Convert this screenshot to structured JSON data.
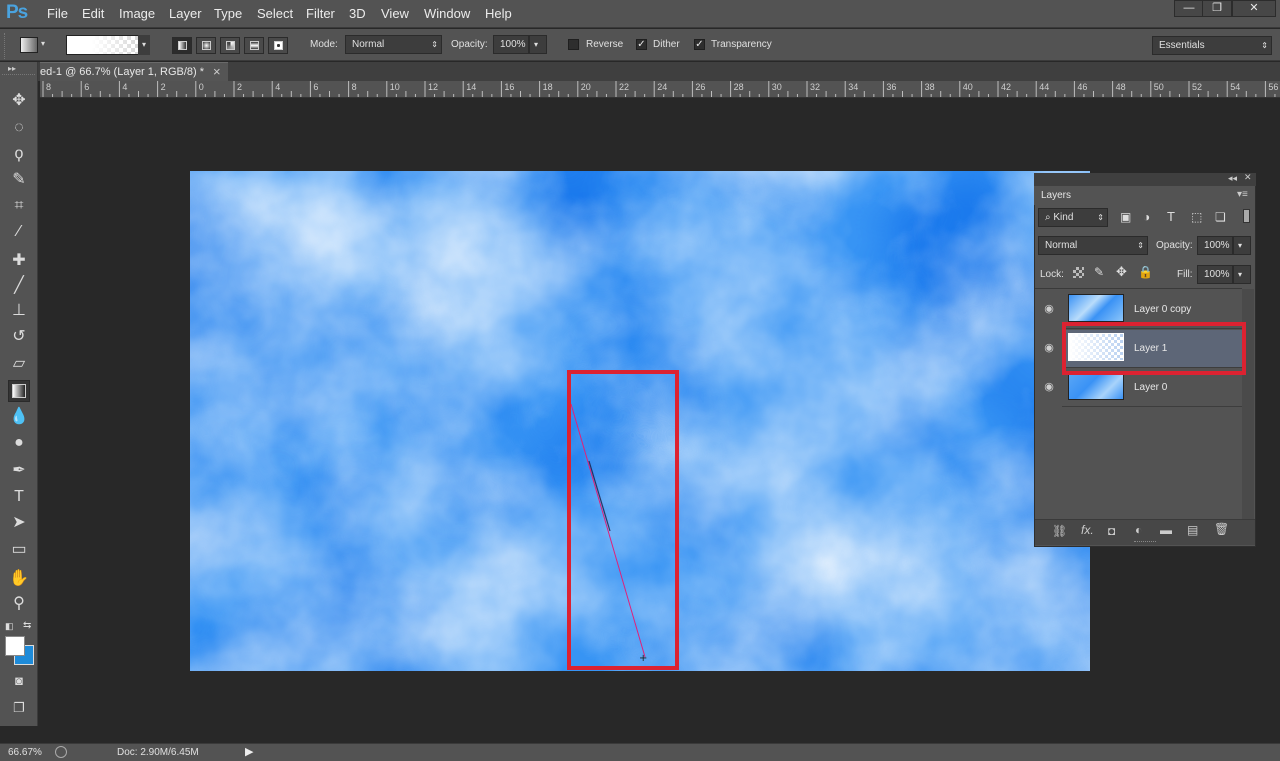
{
  "app": {
    "logo": "Ps"
  },
  "menu": [
    "File",
    "Edit",
    "Image",
    "Layer",
    "Type",
    "Select",
    "Filter",
    "3D",
    "View",
    "Window",
    "Help"
  ],
  "window_controls": {
    "minimize": "—",
    "restore": "❐",
    "close": "✕"
  },
  "options": {
    "mode_label": "Mode:",
    "mode_value": "Normal",
    "opacity_label": "Opacity:",
    "opacity_value": "100%",
    "reverse_label": "Reverse",
    "reverse_checked": false,
    "dither_label": "Dither",
    "dither_checked": true,
    "transparency_label": "Transparency",
    "transparency_checked": true,
    "workspace": "Essentials"
  },
  "document_tab": {
    "title": "ed-1 @ 66.7% (Layer 1, RGB/8) *",
    "close": "×"
  },
  "ruler_labels": [
    "8",
    "6",
    "4",
    "2",
    "0",
    "2",
    "4",
    "6",
    "8",
    "10",
    "12",
    "14",
    "16",
    "18",
    "20",
    "22",
    "24",
    "26",
    "28",
    "30",
    "32",
    "34",
    "36",
    "38",
    "40",
    "42",
    "44",
    "46",
    "48",
    "50",
    "52",
    "54",
    "56"
  ],
  "toolbar_icons": [
    "move-icon",
    "marquee-icon",
    "lasso-icon",
    "quick-select-icon",
    "crop-icon",
    "eyedropper-icon",
    "healing-icon",
    "brush-icon",
    "stamp-icon",
    "history-brush-icon",
    "eraser-icon",
    "gradient-icon",
    "blur-icon",
    "dodge-icon",
    "pen-icon",
    "type-icon",
    "path-select-icon",
    "rectangle-icon",
    "hand-icon",
    "zoom-icon"
  ],
  "layers_panel": {
    "tab_label": "Layers",
    "filter_value": "Kind",
    "blend_mode": "Normal",
    "opacity_label": "Opacity:",
    "opacity_value": "100%",
    "lock_label": "Lock:",
    "fill_label": "Fill:",
    "fill_value": "100%",
    "layers": [
      {
        "name": "Layer 0 copy",
        "selected": false
      },
      {
        "name": "Layer 1",
        "selected": true
      },
      {
        "name": "Layer 0",
        "selected": false
      }
    ]
  },
  "status": {
    "zoom": "66.67%",
    "doc": "Doc: 2.90M/6.45M"
  },
  "colors": {
    "highlight": "#dc2231",
    "sky": "#3a92f5"
  }
}
